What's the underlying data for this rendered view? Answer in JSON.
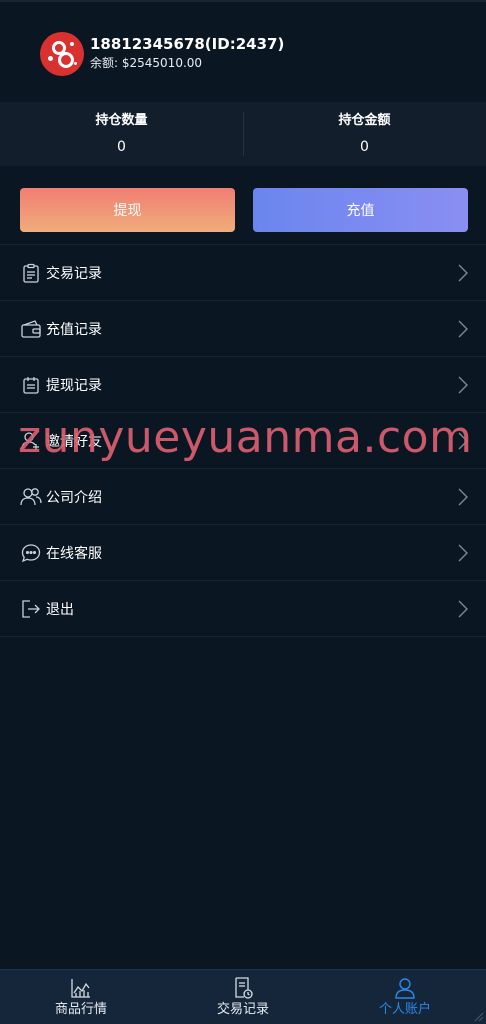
{
  "user": {
    "phone_id": "18812345678(ID:2437)",
    "balance_label": "余额:",
    "balance_value": "$2545010.00"
  },
  "stats": [
    {
      "label": "持仓数量",
      "value": "0"
    },
    {
      "label": "持仓金额",
      "value": "0"
    }
  ],
  "actions": {
    "withdraw": "提现",
    "recharge": "充值"
  },
  "menu": [
    {
      "label": "交易记录",
      "icon": "clipboard-icon"
    },
    {
      "label": "充值记录",
      "icon": "wallet-icon"
    },
    {
      "label": "提现记录",
      "icon": "calendar-list-icon"
    },
    {
      "label": "邀请好友",
      "icon": "add-user-icon"
    },
    {
      "label": "公司介绍",
      "icon": "users-icon"
    },
    {
      "label": "在线客服",
      "icon": "chat-icon"
    },
    {
      "label": "退出",
      "icon": "logout-icon"
    }
  ],
  "watermark": "zunyueyuanma.com",
  "tabbar": [
    {
      "label": "商品行情",
      "icon": "chart-icon",
      "active": false
    },
    {
      "label": "交易记录",
      "icon": "receipt-icon",
      "active": false
    },
    {
      "label": "个人账户",
      "icon": "person-icon",
      "active": true
    }
  ],
  "colors": {
    "background": "#0b1623",
    "panel": "#121e2c",
    "withdraw_gradient": [
      "#f07e74",
      "#f0ad7a"
    ],
    "recharge_gradient": [
      "#6a86ee",
      "#8a8ef2"
    ],
    "active_tab": "#2a88ea",
    "watermark": "#dc6070"
  }
}
